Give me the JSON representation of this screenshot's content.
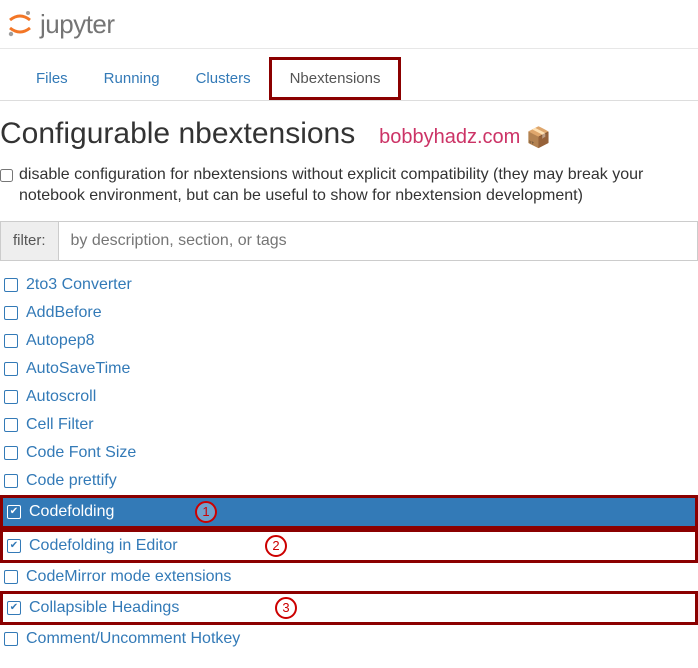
{
  "header": {
    "brand": "jupyter"
  },
  "tabs": [
    {
      "label": "Files",
      "active": false
    },
    {
      "label": "Running",
      "active": false
    },
    {
      "label": "Clusters",
      "active": false
    },
    {
      "label": "Nbextensions",
      "active": true
    }
  ],
  "page": {
    "title": "Configurable nbextensions",
    "watermark": "bobbyhadz.com",
    "disable_label": "disable configuration for nbextensions without explicit compatibility (they may break your notebook environment, but can be useful to show for nbextension development)"
  },
  "filter": {
    "label": "filter:",
    "placeholder": "by description, section, or tags"
  },
  "extensions": [
    {
      "name": "2to3 Converter",
      "checked": false,
      "selected": false,
      "highlight": null
    },
    {
      "name": "AddBefore",
      "checked": false,
      "selected": false,
      "highlight": null
    },
    {
      "name": "Autopep8",
      "checked": false,
      "selected": false,
      "highlight": null
    },
    {
      "name": "AutoSaveTime",
      "checked": false,
      "selected": false,
      "highlight": null
    },
    {
      "name": "Autoscroll",
      "checked": false,
      "selected": false,
      "highlight": null
    },
    {
      "name": "Cell Filter",
      "checked": false,
      "selected": false,
      "highlight": null
    },
    {
      "name": "Code Font Size",
      "checked": false,
      "selected": false,
      "highlight": null
    },
    {
      "name": "Code prettify",
      "checked": false,
      "selected": false,
      "highlight": null
    },
    {
      "name": "Codefolding",
      "checked": true,
      "selected": true,
      "highlight": 1
    },
    {
      "name": "Codefolding in Editor",
      "checked": true,
      "selected": false,
      "highlight": 2
    },
    {
      "name": "CodeMirror mode extensions",
      "checked": false,
      "selected": false,
      "highlight": null
    },
    {
      "name": "Collapsible Headings",
      "checked": true,
      "selected": false,
      "highlight": 3
    },
    {
      "name": "Comment/Uncomment Hotkey",
      "checked": false,
      "selected": false,
      "highlight": null
    }
  ]
}
